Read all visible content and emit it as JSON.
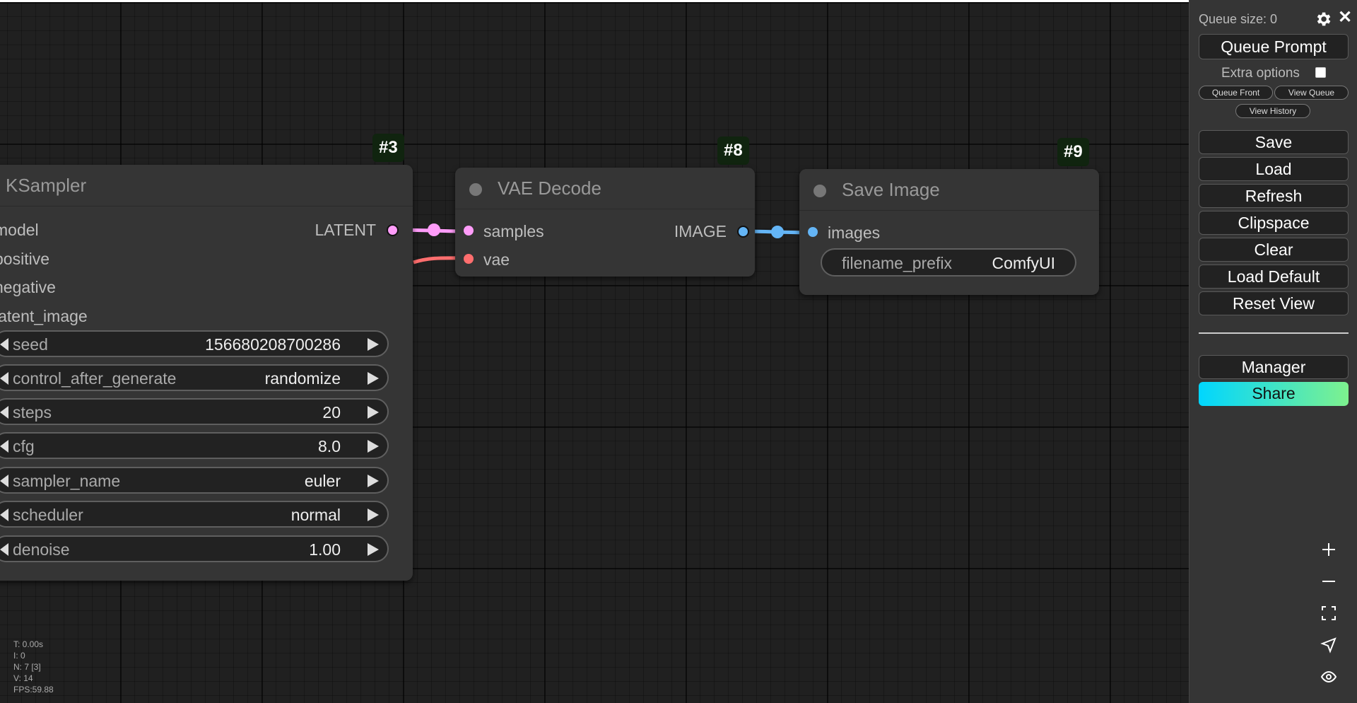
{
  "menu": {
    "queue_size": "Queue size: 0",
    "close": "✕",
    "queue_prompt": "Queue Prompt",
    "extra_options": "Extra options",
    "queue_front": "Queue Front",
    "view_queue": "View Queue",
    "view_history": "View History",
    "save": "Save",
    "load": "Load",
    "refresh": "Refresh",
    "clipspace": "Clipspace",
    "clear": "Clear",
    "load_default": "Load Default",
    "reset_view": "Reset View",
    "manager": "Manager",
    "share": "Share",
    "share_gradient": [
      "#00d6ff",
      "#7ef18e"
    ]
  },
  "nodes": {
    "ksampler": {
      "id": "#3",
      "title": "KSampler",
      "inputs": [
        "model",
        "positive",
        "negative",
        "latent_image"
      ],
      "output": "LATENT",
      "widgets": [
        {
          "label": "seed",
          "value": "156680208700286"
        },
        {
          "label": "control_after_generate",
          "value": "randomize"
        },
        {
          "label": "steps",
          "value": "20"
        },
        {
          "label": "cfg",
          "value": "8.0"
        },
        {
          "label": "sampler_name",
          "value": "euler"
        },
        {
          "label": "scheduler",
          "value": "normal"
        },
        {
          "label": "denoise",
          "value": "1.00"
        }
      ]
    },
    "vae_decode": {
      "id": "#8",
      "title": "VAE Decode",
      "inputs": [
        "samples",
        "vae"
      ],
      "output": "IMAGE"
    },
    "save_image": {
      "id": "#9",
      "title": "Save Image",
      "inputs": [
        "images"
      ],
      "widget": {
        "label": "filename_prefix",
        "value": "ComfyUI"
      }
    }
  },
  "colors": {
    "latent": "#ff9cf9",
    "vae": "#ff6e6e",
    "image": "#64b5f6"
  },
  "stats": {
    "t": "T: 0.00s",
    "i": "I: 0",
    "n": "N: 7 [3]",
    "v": "V: 14",
    "fps": "FPS:59.88"
  },
  "zoom_controls": [
    "zoom-in-icon",
    "zoom-out-icon",
    "fit-view-icon",
    "navigate-icon",
    "visibility-icon"
  ]
}
